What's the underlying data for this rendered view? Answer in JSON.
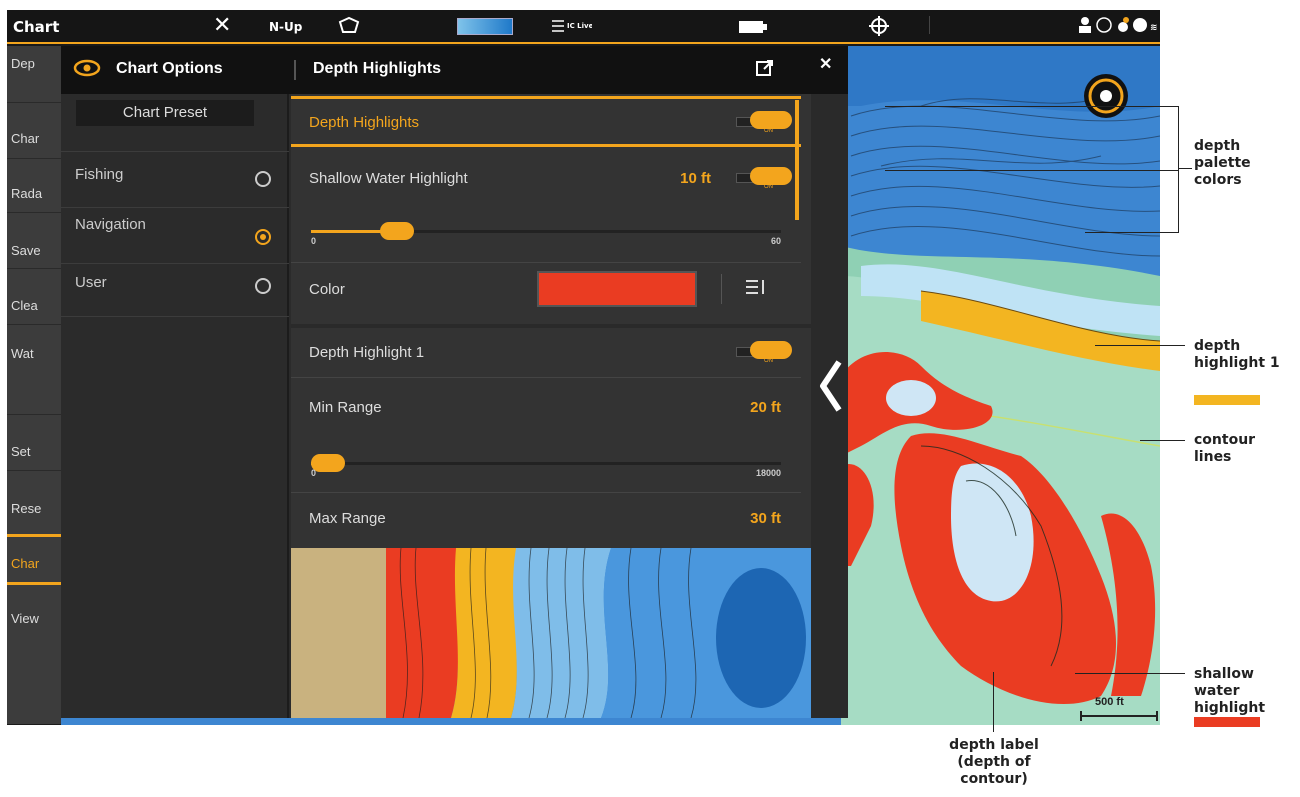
{
  "status_bar": {
    "app_title": "Chart",
    "orientation": "N-Up",
    "layers_label": "≡ IC Live"
  },
  "left_menu": {
    "items": [
      "Dep",
      "Char",
      "Rada",
      "Save",
      "Clea",
      "Wat",
      "Set",
      "Rese",
      "Char",
      "View"
    ]
  },
  "panel": {
    "title": "Chart Options",
    "subtitle": "Depth Highlights",
    "preset_button": "Chart Preset",
    "presets": [
      {
        "label": "Fishing",
        "selected": false
      },
      {
        "label": "Navigation",
        "selected": true
      },
      {
        "label": "User",
        "selected": false
      }
    ],
    "depth_highlights_label": "Depth Highlights",
    "shallow_label": "Shallow Water Highlight",
    "shallow_value": "10 ft",
    "shallow_slider": {
      "value": 10,
      "min": "0",
      "max": "60"
    },
    "color_label": "Color",
    "highlight1_label": "Depth Highlight 1",
    "min_range_label": "Min Range",
    "min_range_value": "20 ft",
    "range_slider": {
      "value": 20,
      "min": "0",
      "max": "18000"
    },
    "max_range_label": "Max Range",
    "max_range_value": "30 ft",
    "toggle_on_text": "ON"
  },
  "map": {
    "scale_label": "500 ft"
  },
  "callouts": {
    "palette": "depth\npalette\ncolors",
    "highlight1": "depth\nhighlight 1",
    "contour": "contour\nlines",
    "shallow": "shallow\nwater\nhighlight",
    "depth_label": "depth label\n(depth of\ncontour)"
  },
  "colors": {
    "accent": "#f3a51d",
    "shallow_red": "#ea3c22",
    "highlight_yellow": "#f3b521",
    "deep_blue": "#3f8fd8",
    "mid_blue": "#6cb2e4",
    "green": "#8fd0b4"
  }
}
